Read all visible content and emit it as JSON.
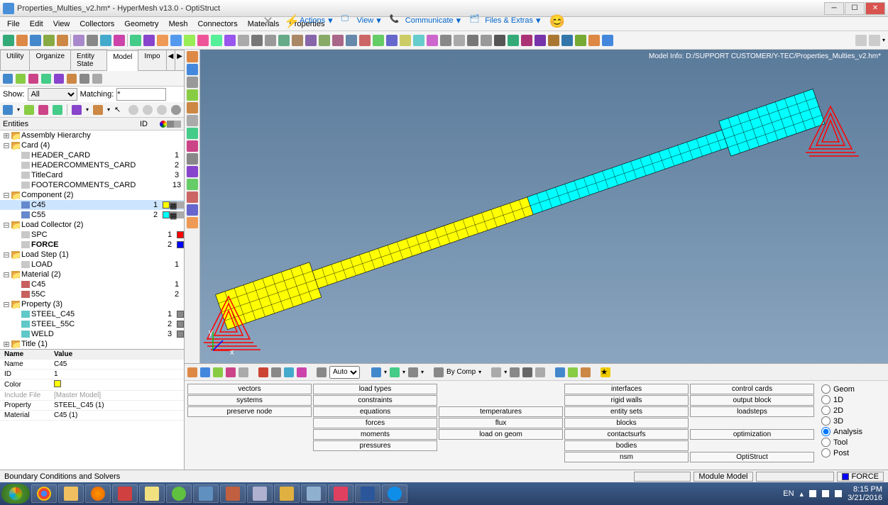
{
  "window": {
    "title": "Properties_Multies_v2.hm* - HyperMesh v13.0 - OptiStruct"
  },
  "menubar": [
    "File",
    "Edit",
    "View",
    "Collectors",
    "Geometry",
    "Mesh",
    "Connectors",
    "Materials",
    "Properties"
  ],
  "bigactions": {
    "a1": "Actions",
    "a2": "View",
    "a3": "Communicate",
    "a4": "Files & Extras"
  },
  "panel_tabs": {
    "t1": "Utility",
    "t2": "Organize",
    "t3": "Entity State",
    "t4": "Model",
    "t5": "Impo"
  },
  "filter": {
    "show": "Show:",
    "all": "All",
    "matching": "Matching:",
    "star": "*"
  },
  "treehdr": {
    "ent": "Entities",
    "id": "ID"
  },
  "tree": {
    "r0": "Assembly Hierarchy",
    "r1": "Card (4)",
    "r1a": "HEADER_CARD",
    "r1a_id": "1",
    "r1b": "HEADERCOMMENTS_CARD",
    "r1b_id": "2",
    "r1c": "TitleCard",
    "r1c_id": "3",
    "r1d": "FOOTERCOMMENTS_CARD",
    "r1d_id": "13",
    "r2": "Component (2)",
    "r2a": "C45",
    "r2a_id": "1",
    "r2b": "C55",
    "r2b_id": "2",
    "r3": "Load Collector (2)",
    "r3a": "SPC",
    "r3a_id": "1",
    "r3b": "FORCE",
    "r3b_id": "2",
    "r4": "Load Step (1)",
    "r4a": "LOAD",
    "r4a_id": "1",
    "r5": "Material (2)",
    "r5a": "C45",
    "r5a_id": "1",
    "r5b": "55C",
    "r5b_id": "2",
    "r6": "Property (3)",
    "r6a": "STEEL_C45",
    "r6a_id": "1",
    "r6b": "STEEL_55C",
    "r6b_id": "2",
    "r6c": "WELD",
    "r6c_id": "3",
    "r7": "Title (1)"
  },
  "prophdr": {
    "n": "Name",
    "v": "Value"
  },
  "props": {
    "p1n": "Name",
    "p1v": "C45",
    "p2n": "ID",
    "p2v": "1",
    "p3n": "Color",
    "p3v": "",
    "p4n": "Include File",
    "p4v": "[Master Model]",
    "p5n": "Property",
    "p5v": "STEEL_C45 (1)",
    "p6n": "Material",
    "p6v": "C45 (1)"
  },
  "modelinfo": "Model Info: D:/SUPPORT CUSTOMER/Y-TEC/Properties_Multies_v2.hm*",
  "vptool": {
    "auto": "Auto",
    "bycomp": "By Comp"
  },
  "panels": {
    "c1": [
      "vectors",
      "systems",
      "preserve node"
    ],
    "c2": [
      "load types",
      "constraints",
      "equations",
      "forces",
      "moments",
      "pressures"
    ],
    "c3": [
      "",
      "",
      "temperatures",
      "flux",
      "load on geom"
    ],
    "c4": [
      "interfaces",
      "rigid walls",
      "entity sets",
      "blocks",
      "contactsurfs",
      "bodies",
      "nsm"
    ],
    "c5": [
      "control cards",
      "output block",
      "loadsteps",
      "",
      "optimization",
      "",
      "OptiStruct"
    ]
  },
  "radios": [
    "Geom",
    "1D",
    "2D",
    "3D",
    "Analysis",
    "Tool",
    "Post"
  ],
  "status": {
    "left": "Boundary Conditions and Solvers",
    "mod": "Module Model",
    "force": "FORCE"
  },
  "tray": {
    "lang": "EN",
    "time": "8:15 PM",
    "date": "3/21/2016"
  }
}
